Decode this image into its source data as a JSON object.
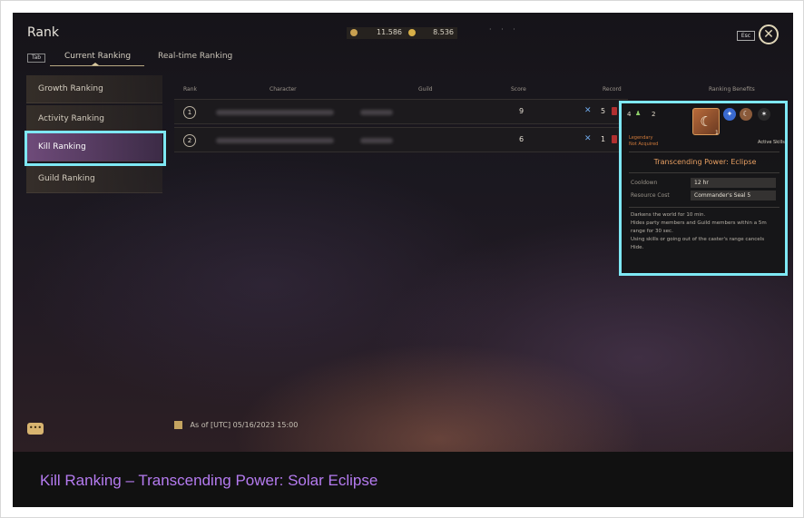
{
  "header": {
    "title": "Rank",
    "currency1": "11.586",
    "currency2": "8.536",
    "esc_label": "Esc",
    "close_glyph": "✕"
  },
  "tabs": {
    "tab_key": "Tab",
    "current": "Current Ranking",
    "realtime": "Real-time Ranking"
  },
  "sidebar": {
    "items": [
      {
        "label": "Growth Ranking"
      },
      {
        "label": "Activity Ranking"
      },
      {
        "label": "Kill Ranking"
      },
      {
        "label": "Guild Ranking"
      }
    ]
  },
  "table": {
    "headers": [
      "Rank",
      "Character",
      "Guild",
      "Score",
      "Record",
      "Ranking Benefits"
    ],
    "rows": [
      {
        "rank": "1",
        "score": "9",
        "kills": "5"
      },
      {
        "rank": "2",
        "score": "6",
        "kills": "1"
      }
    ]
  },
  "tooltip": {
    "count1": "4",
    "count2": "2",
    "icon_badge": "1",
    "status_line1": "Legendary",
    "status_line2": "Not Acquired",
    "category": "Active Skills",
    "name": "Transcending Power: Eclipse",
    "cooldown_label": "Cooldown",
    "cooldown_value": "12 hr",
    "resource_label": "Resource Cost",
    "resource_value": "Commander's Seal 5",
    "desc_line1": "Darkens the world for 10 min.",
    "desc_line2": "Hides party members and Guild members within a 5m",
    "desc_line3": "range for 30 sec.",
    "desc_line4": "Using skills or going out of the caster's range cancels",
    "desc_line5": "Hide."
  },
  "footer": {
    "as_of": "As of [UTC] 05/16/2023 15:00"
  },
  "caption": "Kill Ranking – Transcending Power: Solar Eclipse",
  "colors": {
    "highlight": "#7ee8f4",
    "selected_sidebar": "#6f4b7a",
    "caption_text": "#b57bf0",
    "skill_name": "#e8a062"
  }
}
